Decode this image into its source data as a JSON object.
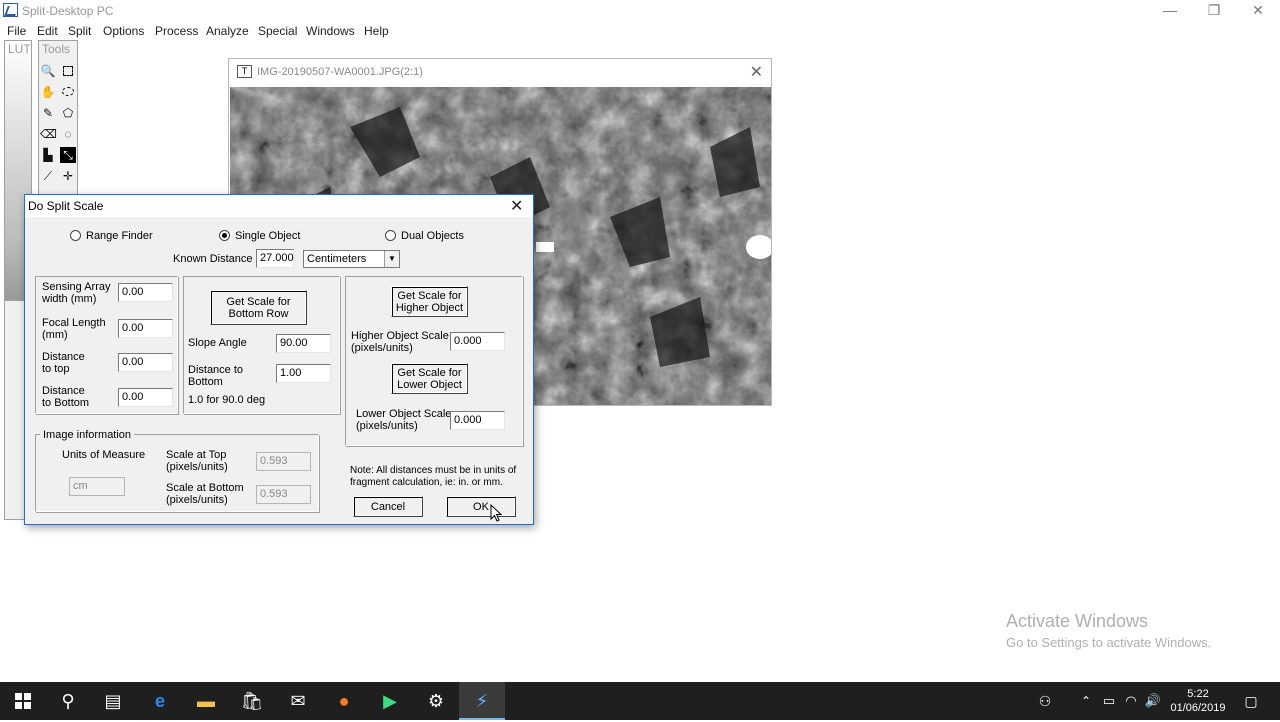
{
  "app": {
    "title": "Split-Desktop PC",
    "menu": [
      "File",
      "Edit",
      "Split",
      "Options",
      "Process",
      "Analyze",
      "Special",
      "Windows",
      "Help"
    ],
    "window_controls": {
      "minimize": "—",
      "restore": "❐",
      "close": "✕"
    }
  },
  "panels": {
    "lut_label": "LUT",
    "tools_label": "Tools"
  },
  "image_window": {
    "title": "IMG-20190507-WA0001.JPG(2:1)",
    "close": "✕"
  },
  "dialog": {
    "title": "Do Split Scale",
    "close": "✕",
    "modes": [
      {
        "label": "Range Finder",
        "selected": false
      },
      {
        "label": "Single Object",
        "selected": true
      },
      {
        "label": "Dual Objects",
        "selected": false
      }
    ],
    "known_distance": {
      "label": "Known Distance",
      "value": "27.000",
      "unit": "Centimeters"
    },
    "range_finder": {
      "sensing_array": {
        "label_1": "Sensing Array",
        "label_2": "width (mm)",
        "value": "0.00"
      },
      "focal_length": {
        "label_1": "Focal Length",
        "label_2": "(mm)",
        "value": "0.00"
      },
      "distance_top": {
        "label_1": "Distance",
        "label_2": "to top",
        "value": "0.00"
      },
      "distance_bottom": {
        "label_1": "Distance",
        "label_2": "to Bottom",
        "value": "0.00"
      }
    },
    "single_object": {
      "get_scale_button": {
        "line_1": "Get Scale for",
        "line_2": "Bottom Row"
      },
      "slope_angle": {
        "label": "Slope Angle",
        "value": "90.00"
      },
      "distance_to_bottom": {
        "label_1": "Distance to",
        "label_2": "Bottom",
        "value": "1.00"
      },
      "hint": "1.0 for 90.0 deg"
    },
    "dual_objects": {
      "get_higher_button": {
        "line_1": "Get Scale for",
        "line_2": "Higher Object"
      },
      "higher_scale": {
        "label_1": "Higher Object Scale",
        "label_2": "(pixels/units)",
        "value": "0.000"
      },
      "get_lower_button": {
        "line_1": "Get Scale for",
        "line_2": "Lower Object"
      },
      "lower_scale": {
        "label_1": "Lower Object Scale",
        "label_2": "(pixels/units)",
        "value": "0.000"
      }
    },
    "image_info": {
      "legend": "Image information",
      "units_label": "Units of Measure",
      "units_value": "cm",
      "scale_top": {
        "label_1": "Scale at Top",
        "label_2": "(pixels/units)",
        "value": "0.593"
      },
      "scale_bottom": {
        "label_1": "Scale at Bottom",
        "label_2": "(pixels/units)",
        "value": "0.593"
      }
    },
    "note_1": "Note:  All distances must be in units of",
    "note_2": "fragment calculation, ie: in. or mm.",
    "cancel": "Cancel",
    "ok": "OK"
  },
  "watermark": {
    "line_1": "Activate Windows",
    "line_2": "Go to Settings to activate Windows."
  },
  "taskbar": {
    "time": "5:22",
    "date": "01/06/2019"
  }
}
